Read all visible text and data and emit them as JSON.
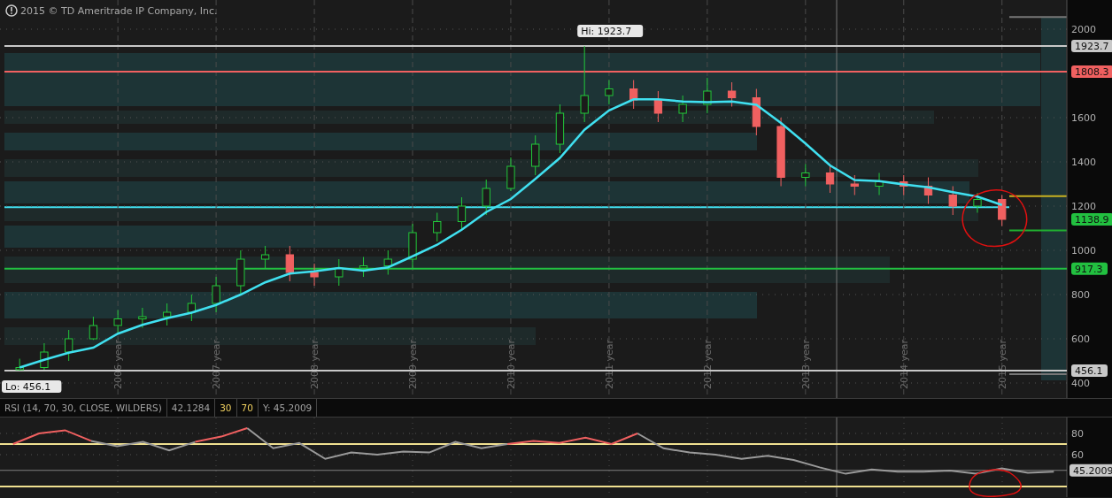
{
  "notice": {
    "text": "2015 © TD Ameritrade IP Company, Inc."
  },
  "price_chart": {
    "chart_data": {
      "type": "candlestick",
      "grid": true,
      "x": [
        2005,
        2005.25,
        2005.5,
        2005.75,
        2006,
        2006.25,
        2006.5,
        2006.75,
        2007,
        2007.25,
        2007.5,
        2007.75,
        2008,
        2008.25,
        2008.5,
        2008.75,
        2009,
        2009.25,
        2009.5,
        2009.75,
        2010,
        2010.25,
        2010.5,
        2010.75,
        2011,
        2011.25,
        2011.5,
        2011.75,
        2012,
        2012.25,
        2012.5,
        2012.75,
        2013,
        2013.25,
        2013.5,
        2013.75,
        2014,
        2014.25,
        2014.5,
        2014.75,
        2015
      ],
      "ohlc": [
        [
          460,
          510,
          456.1,
          470
        ],
        [
          470,
          580,
          460,
          540
        ],
        [
          540,
          640,
          500,
          600
        ],
        [
          600,
          700,
          595,
          660
        ],
        [
          660,
          730,
          620,
          690
        ],
        [
          690,
          740,
          650,
          700
        ],
        [
          700,
          760,
          660,
          720
        ],
        [
          720,
          800,
          680,
          760
        ],
        [
          760,
          880,
          720,
          840
        ],
        [
          840,
          1000,
          800,
          960
        ],
        [
          960,
          1020,
          920,
          980
        ],
        [
          980,
          1020,
          860,
          900
        ],
        [
          900,
          940,
          840,
          880
        ],
        [
          880,
          960,
          840,
          920
        ],
        [
          920,
          970,
          880,
          930
        ],
        [
          930,
          1000,
          890,
          960
        ],
        [
          960,
          1120,
          920,
          1080
        ],
        [
          1080,
          1170,
          1040,
          1130
        ],
        [
          1130,
          1240,
          1090,
          1200
        ],
        [
          1200,
          1320,
          1160,
          1280
        ],
        [
          1280,
          1420,
          1268,
          1380
        ],
        [
          1380,
          1520,
          1340,
          1480
        ],
        [
          1480,
          1660,
          1440,
          1620
        ],
        [
          1620,
          1923.7,
          1580,
          1700
        ],
        [
          1700,
          1770,
          1660,
          1730
        ],
        [
          1730,
          1770,
          1640,
          1680
        ],
        [
          1680,
          1720,
          1580,
          1620
        ],
        [
          1620,
          1700,
          1580,
          1660
        ],
        [
          1660,
          1780,
          1620,
          1720
        ],
        [
          1720,
          1760,
          1650,
          1690
        ],
        [
          1690,
          1730,
          1520,
          1560
        ],
        [
          1560,
          1600,
          1290,
          1330
        ],
        [
          1330,
          1390,
          1290,
          1350
        ],
        [
          1350,
          1380,
          1260,
          1300
        ],
        [
          1300,
          1340,
          1250,
          1290
        ],
        [
          1290,
          1350,
          1250,
          1310
        ],
        [
          1310,
          1340,
          1250,
          1290
        ],
        [
          1290,
          1330,
          1210,
          1250
        ],
        [
          1250,
          1290,
          1160,
          1200
        ],
        [
          1200,
          1260,
          1170,
          1230
        ],
        [
          1230,
          1250,
          1110,
          1140
        ]
      ],
      "series": [
        {
          "type": "line",
          "color": "#40e0f0",
          "values": [
            470,
            505,
            537,
            560,
            623,
            663,
            693,
            718,
            753,
            800,
            855,
            895,
            905,
            920,
            908,
            923,
            973,
            1025,
            1093,
            1173,
            1232,
            1323,
            1418,
            1545,
            1633,
            1683,
            1683,
            1673,
            1670,
            1673,
            1658,
            1576,
            1483,
            1384,
            1318,
            1313,
            1298,
            1285,
            1263,
            1243,
            1205
          ]
        }
      ],
      "xlim": [
        2004.8,
        2016.12
      ],
      "xticks": [
        {
          "value": 2006,
          "label": "2006 year"
        },
        {
          "value": 2007,
          "label": "2007 year"
        },
        {
          "value": 2008,
          "label": "2008 year"
        },
        {
          "value": 2009,
          "label": "2009 year"
        },
        {
          "value": 2010,
          "label": "2010 year"
        },
        {
          "value": 2011,
          "label": "2011 year"
        },
        {
          "value": 2012,
          "label": "2012 year"
        },
        {
          "value": 2013,
          "label": "2013 year"
        },
        {
          "value": 2014,
          "label": "2014 year"
        },
        {
          "value": 2015,
          "label": "2015 year"
        }
      ],
      "yticks": [
        400,
        600,
        800,
        1000,
        1200,
        1400,
        1600,
        2000
      ],
      "ylim": [
        332,
        2132
      ],
      "ref_lines": [
        {
          "axis": "y",
          "value": 1923.7,
          "label": "1923.7",
          "color": "#c8c8c8"
        },
        {
          "axis": "y",
          "value": 1808.3,
          "label": "1808.3",
          "color": "#f06060"
        },
        {
          "axis": "y",
          "value": 917.3,
          "label": "917.3",
          "color": "#22c040"
        },
        {
          "axis": "y",
          "value": 456.1,
          "label": "456.1",
          "color": "#c8c8c8"
        }
      ],
      "annotations": [
        "1138.9",
        {
          "text": "Hi: 1923.7",
          "x": 2010.75,
          "y": 1923.7
        },
        {
          "text": "Lo: 456.1",
          "x": 2005,
          "y": 456.1
        }
      ]
    }
  },
  "rsi_panel": {
    "header": [
      {
        "text": "RSI (14, 70, 30, CLOSE, WILDERS)",
        "color": "#a0a0a0"
      },
      {
        "text": "42.1284",
        "color": "#a0a0a0"
      },
      {
        "text": "30",
        "color": "#f0d060"
      },
      {
        "text": "70",
        "color": "#f0d060"
      },
      {
        "text": "Y: 45.2009",
        "color": "#a0a0a0"
      }
    ],
    "chart_data": {
      "type": "line",
      "grid": true,
      "series": [
        {
          "color": "#9a9a9a",
          "values": [
            null,
            null,
            null,
            73,
            68,
            72,
            64,
            72,
            null,
            85,
            66,
            71,
            56,
            62,
            60,
            63,
            62,
            72,
            66,
            70,
            null,
            null,
            null,
            null,
            80,
            66,
            62,
            60,
            56,
            59,
            55,
            48,
            42,
            46,
            44,
            44,
            45,
            42,
            47,
            43,
            44
          ]
        },
        {
          "color": "#f06060",
          "values": [
            70,
            80,
            83,
            73,
            null,
            null,
            null,
            72,
            77,
            85,
            null,
            null,
            null,
            null,
            null,
            null,
            null,
            null,
            null,
            70,
            73,
            71,
            76,
            70,
            80,
            null,
            null,
            null,
            null,
            null,
            null,
            null,
            null,
            null,
            null,
            null,
            null,
            null,
            null,
            null,
            null
          ]
        }
      ],
      "yticks": [
        60,
        80
      ],
      "ylim": [
        20,
        95
      ],
      "ref_lines": [
        {
          "axis": "y",
          "value": 70,
          "color": "#f0e090"
        },
        {
          "axis": "y",
          "value": 30,
          "color": "#f0e090"
        },
        {
          "axis": "y",
          "value": 45.2009,
          "label": "45.2009",
          "color": "#808080"
        }
      ]
    }
  }
}
